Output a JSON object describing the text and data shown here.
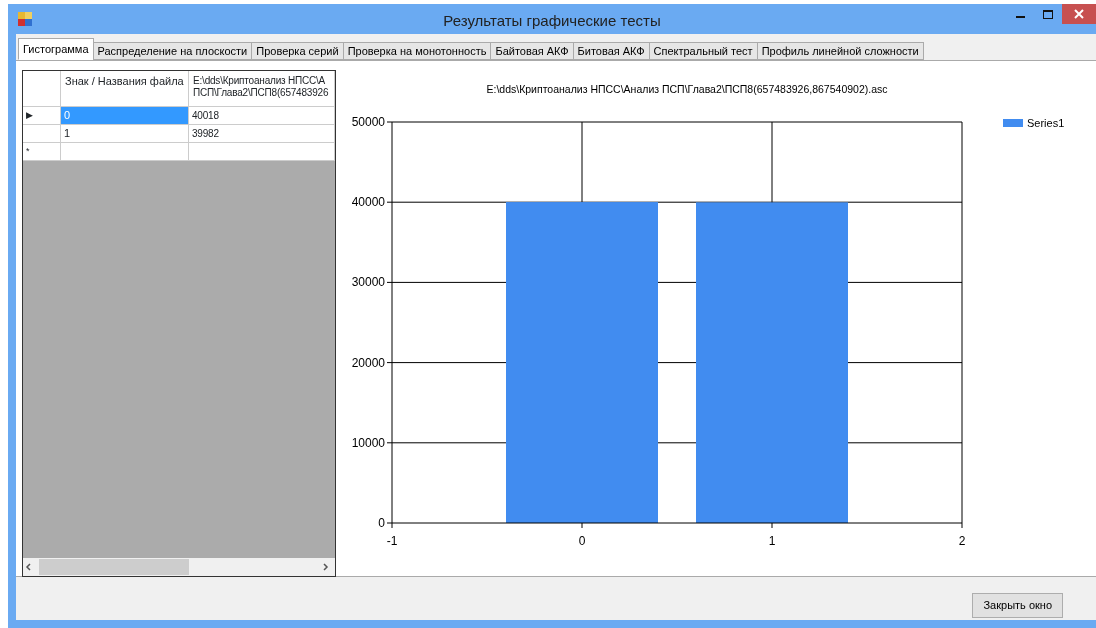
{
  "window": {
    "title": "Результаты графические тесты"
  },
  "tabs": [
    {
      "label": "Гистограмма",
      "selected": true
    },
    {
      "label": "Распределение на плоскости",
      "selected": false
    },
    {
      "label": "Проверка серий",
      "selected": false
    },
    {
      "label": "Проверка на монотонность",
      "selected": false
    },
    {
      "label": "Байтовая АКФ",
      "selected": false
    },
    {
      "label": "Битовая АКФ",
      "selected": false
    },
    {
      "label": "Спектральный тест",
      "selected": false
    },
    {
      "label": "Профиль линейной сложности",
      "selected": false
    }
  ],
  "table": {
    "columns": [
      "Знак / Названия файла",
      "E:\\dds\\Криптоанализ НПСС\\А ПСП\\Глава2\\ПСП8(657483926"
    ],
    "rows": [
      {
        "marker": "▶",
        "cells": [
          "0",
          "40018"
        ],
        "selected": true
      },
      {
        "cells": [
          "1",
          "39982"
        ],
        "selected": false
      },
      {
        "marker": "*",
        "selected": false
      }
    ]
  },
  "chart": {
    "chart_data": {
      "type": "bar",
      "title": "E:\\dds\\Криптоанализ НПСС\\Анализ ПСП\\Глава2\\ПСП8(657483926,867540902).asc",
      "x": [
        0,
        1
      ],
      "series": [
        {
          "name": "Series1",
          "color": "#418cf0",
          "values": [
            40018,
            39982
          ]
        }
      ],
      "xlim": [
        -1,
        2
      ],
      "ylim": [
        0,
        50000
      ],
      "xticks": [
        -1,
        0,
        1,
        2
      ],
      "yticks": [
        0,
        10000,
        20000,
        30000,
        40000,
        50000
      ],
      "grid": true
    }
  },
  "buttons": [
    {
      "label": "Закрыть окно"
    }
  ]
}
